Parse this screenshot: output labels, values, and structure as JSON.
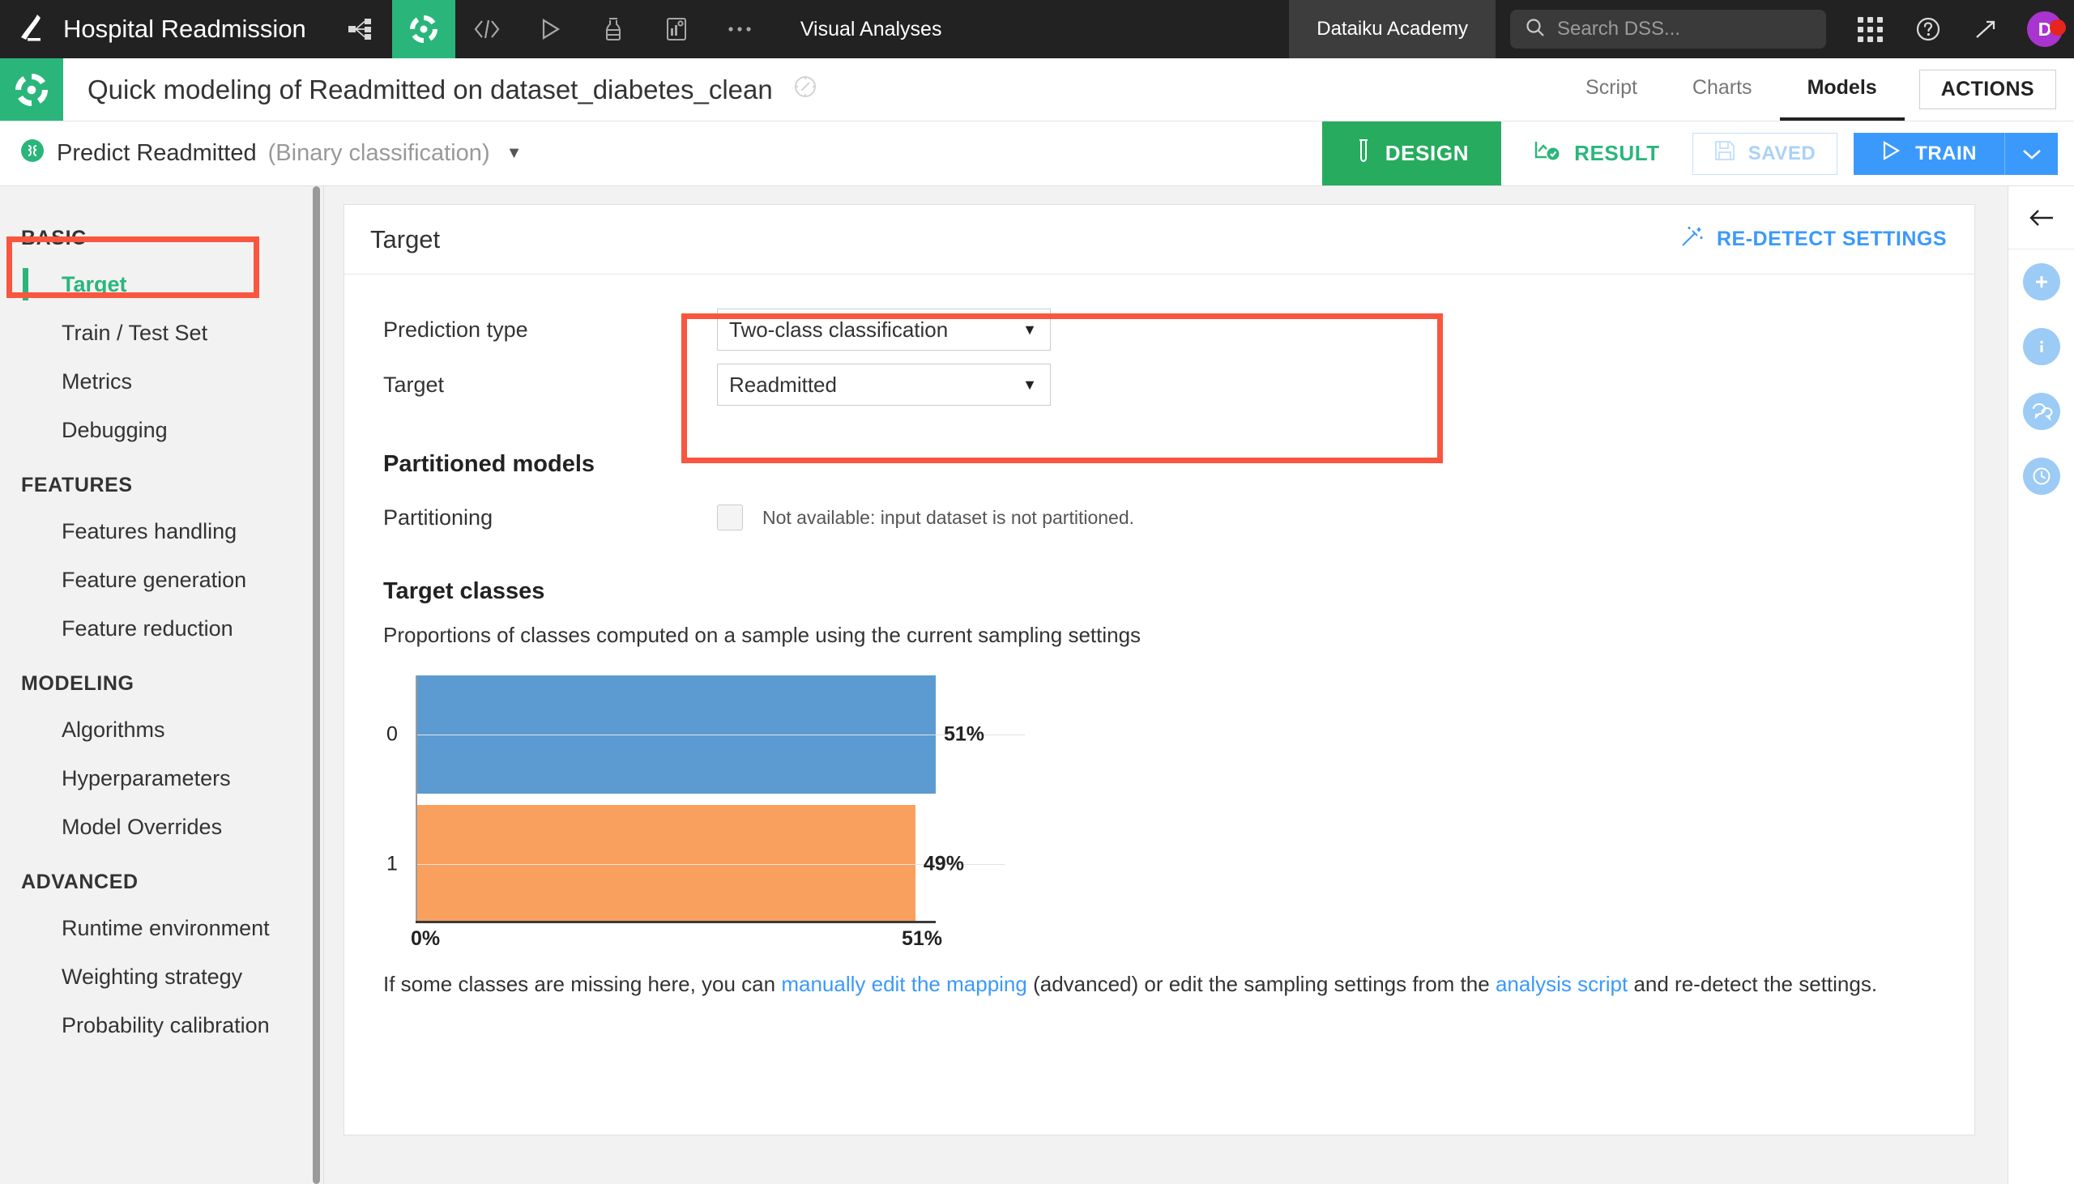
{
  "topnav": {
    "logo_icon": "dataiku-bird-logo",
    "project_name": "Hospital Readmission",
    "icons": [
      {
        "name": "flow-icon",
        "label": "Flow"
      },
      {
        "name": "lab-icon",
        "label": "Lab",
        "active": true
      },
      {
        "name": "code-icon",
        "label": "Code"
      },
      {
        "name": "run-icon",
        "label": "Jobs"
      },
      {
        "name": "lab-flask-icon",
        "label": "Lab"
      },
      {
        "name": "dashboard-icon",
        "label": "Dashboards"
      },
      {
        "name": "more-icon",
        "label": "More"
      }
    ],
    "section_label": "Visual Analyses",
    "academy_label": "Dataiku Academy",
    "search": {
      "placeholder": "Search DSS...",
      "value": "",
      "icon": "search-icon"
    },
    "apps_icon": "apps-grid-icon",
    "help_icon": "help-circle-icon",
    "trending_icon": "trending-up-icon",
    "avatar_initial": "D",
    "avatar_color": "#a934cf",
    "notification_color": "#e7251f"
  },
  "titlebar": {
    "badge_icon": "visual-analysis-icon",
    "title": "Quick modeling of Readmitted on dataset_diabetes_clean",
    "compass_icon": "compass-icon",
    "tabs": [
      {
        "label": "Script",
        "active": false
      },
      {
        "label": "Charts",
        "active": false
      },
      {
        "label": "Models",
        "active": true
      }
    ],
    "actions_label": "ACTIONS"
  },
  "subheader": {
    "model_icon": "model-circle-icon",
    "model_name": "Predict Readmitted",
    "model_type": "(Binary classification)",
    "caret": "▼",
    "segments": [
      {
        "label": "DESIGN",
        "icon": "test-tube-icon",
        "active": true
      },
      {
        "label": "RESULT",
        "icon": "result-check-icon",
        "active": false
      }
    ],
    "saved_label": "SAVED",
    "saved_icon": "floppy-disk-icon",
    "train_label": "TRAIN",
    "train_icon": "play-icon",
    "train_caret_icon": "chevron-down-icon",
    "train_color": "#3b99fc"
  },
  "sidebar": {
    "groups": [
      {
        "title": "BASIC",
        "items": [
          {
            "label": "Target",
            "active": true
          },
          {
            "label": "Train / Test Set",
            "active": false
          },
          {
            "label": "Metrics",
            "active": false
          },
          {
            "label": "Debugging",
            "active": false
          }
        ]
      },
      {
        "title": "FEATURES",
        "items": [
          {
            "label": "Features handling",
            "active": false
          },
          {
            "label": "Feature generation",
            "active": false
          },
          {
            "label": "Feature reduction",
            "active": false
          }
        ]
      },
      {
        "title": "MODELING",
        "items": [
          {
            "label": "Algorithms",
            "active": false
          },
          {
            "label": "Hyperparameters",
            "active": false
          },
          {
            "label": "Model Overrides",
            "active": false
          }
        ]
      },
      {
        "title": "ADVANCED",
        "items": [
          {
            "label": "Runtime environment",
            "active": false
          },
          {
            "label": "Weighting strategy",
            "active": false
          },
          {
            "label": "Probability calibration",
            "active": false
          }
        ]
      }
    ]
  },
  "panel": {
    "title": "Target",
    "redetect_label": "RE-DETECT SETTINGS",
    "redetect_icon": "magic-wand-icon",
    "fields": [
      {
        "label": "Prediction type",
        "value": "Two-class classification"
      },
      {
        "label": "Target",
        "value": "Readmitted"
      }
    ],
    "partitioned": {
      "section_title": "Partitioned models",
      "row_label": "Partitioning",
      "checkbox_checked": false,
      "note": "Not available: input dataset is not partitioned."
    },
    "target_classes": {
      "section_title": "Target classes",
      "subtitle": "Proportions of classes computed on a sample using the current sampling settings"
    },
    "footnote": {
      "part1": "If some classes are missing here, you can ",
      "link1": "manually edit the mapping",
      "part2": " (advanced) or edit the sampling settings from the ",
      "link2": "analysis script",
      "part3": " and re-detect the settings."
    }
  },
  "annotations": {
    "highlight_color": "#f9553f",
    "boxes": [
      "sidebar-target-item",
      "target-fields-group"
    ]
  },
  "rightrail": {
    "back_icon": "arrow-left-icon",
    "buttons": [
      {
        "name": "add-icon",
        "glyph": "+"
      },
      {
        "name": "info-icon",
        "glyph": "i"
      },
      {
        "name": "discussions-icon",
        "glyph": "chat"
      },
      {
        "name": "history-icon",
        "glyph": "clock"
      }
    ]
  },
  "chart_data": {
    "type": "bar",
    "orientation": "horizontal",
    "title": "Target classes",
    "categories": [
      "0",
      "1"
    ],
    "values": [
      51,
      49
    ],
    "value_labels": [
      "51%",
      "49%"
    ],
    "colors": [
      "#5b9bd1",
      "#f9a05e"
    ],
    "xlabel": "",
    "ylabel": "",
    "xlim": [
      0,
      51
    ],
    "x_tick_labels": [
      "0%",
      "51%"
    ],
    "grid": true,
    "legend": "none"
  }
}
